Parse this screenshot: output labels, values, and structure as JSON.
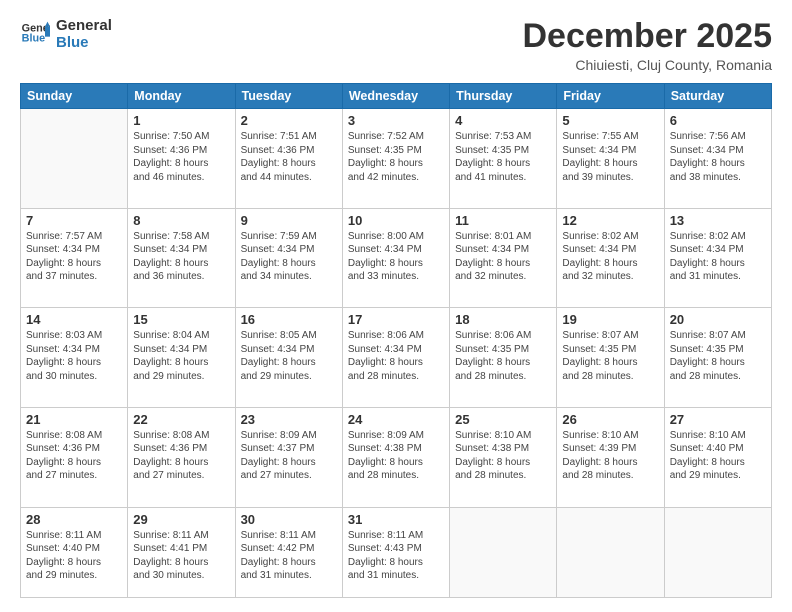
{
  "header": {
    "logo_line1": "General",
    "logo_line2": "Blue",
    "month": "December 2025",
    "location": "Chiuiesti, Cluj County, Romania"
  },
  "days_of_week": [
    "Sunday",
    "Monday",
    "Tuesday",
    "Wednesday",
    "Thursday",
    "Friday",
    "Saturday"
  ],
  "weeks": [
    [
      {
        "day": "",
        "info": ""
      },
      {
        "day": "1",
        "info": "Sunrise: 7:50 AM\nSunset: 4:36 PM\nDaylight: 8 hours\nand 46 minutes."
      },
      {
        "day": "2",
        "info": "Sunrise: 7:51 AM\nSunset: 4:36 PM\nDaylight: 8 hours\nand 44 minutes."
      },
      {
        "day": "3",
        "info": "Sunrise: 7:52 AM\nSunset: 4:35 PM\nDaylight: 8 hours\nand 42 minutes."
      },
      {
        "day": "4",
        "info": "Sunrise: 7:53 AM\nSunset: 4:35 PM\nDaylight: 8 hours\nand 41 minutes."
      },
      {
        "day": "5",
        "info": "Sunrise: 7:55 AM\nSunset: 4:34 PM\nDaylight: 8 hours\nand 39 minutes."
      },
      {
        "day": "6",
        "info": "Sunrise: 7:56 AM\nSunset: 4:34 PM\nDaylight: 8 hours\nand 38 minutes."
      }
    ],
    [
      {
        "day": "7",
        "info": "Sunrise: 7:57 AM\nSunset: 4:34 PM\nDaylight: 8 hours\nand 37 minutes."
      },
      {
        "day": "8",
        "info": "Sunrise: 7:58 AM\nSunset: 4:34 PM\nDaylight: 8 hours\nand 36 minutes."
      },
      {
        "day": "9",
        "info": "Sunrise: 7:59 AM\nSunset: 4:34 PM\nDaylight: 8 hours\nand 34 minutes."
      },
      {
        "day": "10",
        "info": "Sunrise: 8:00 AM\nSunset: 4:34 PM\nDaylight: 8 hours\nand 33 minutes."
      },
      {
        "day": "11",
        "info": "Sunrise: 8:01 AM\nSunset: 4:34 PM\nDaylight: 8 hours\nand 32 minutes."
      },
      {
        "day": "12",
        "info": "Sunrise: 8:02 AM\nSunset: 4:34 PM\nDaylight: 8 hours\nand 32 minutes."
      },
      {
        "day": "13",
        "info": "Sunrise: 8:02 AM\nSunset: 4:34 PM\nDaylight: 8 hours\nand 31 minutes."
      }
    ],
    [
      {
        "day": "14",
        "info": "Sunrise: 8:03 AM\nSunset: 4:34 PM\nDaylight: 8 hours\nand 30 minutes."
      },
      {
        "day": "15",
        "info": "Sunrise: 8:04 AM\nSunset: 4:34 PM\nDaylight: 8 hours\nand 29 minutes."
      },
      {
        "day": "16",
        "info": "Sunrise: 8:05 AM\nSunset: 4:34 PM\nDaylight: 8 hours\nand 29 minutes."
      },
      {
        "day": "17",
        "info": "Sunrise: 8:06 AM\nSunset: 4:34 PM\nDaylight: 8 hours\nand 28 minutes."
      },
      {
        "day": "18",
        "info": "Sunrise: 8:06 AM\nSunset: 4:35 PM\nDaylight: 8 hours\nand 28 minutes."
      },
      {
        "day": "19",
        "info": "Sunrise: 8:07 AM\nSunset: 4:35 PM\nDaylight: 8 hours\nand 28 minutes."
      },
      {
        "day": "20",
        "info": "Sunrise: 8:07 AM\nSunset: 4:35 PM\nDaylight: 8 hours\nand 28 minutes."
      }
    ],
    [
      {
        "day": "21",
        "info": "Sunrise: 8:08 AM\nSunset: 4:36 PM\nDaylight: 8 hours\nand 27 minutes."
      },
      {
        "day": "22",
        "info": "Sunrise: 8:08 AM\nSunset: 4:36 PM\nDaylight: 8 hours\nand 27 minutes."
      },
      {
        "day": "23",
        "info": "Sunrise: 8:09 AM\nSunset: 4:37 PM\nDaylight: 8 hours\nand 27 minutes."
      },
      {
        "day": "24",
        "info": "Sunrise: 8:09 AM\nSunset: 4:38 PM\nDaylight: 8 hours\nand 28 minutes."
      },
      {
        "day": "25",
        "info": "Sunrise: 8:10 AM\nSunset: 4:38 PM\nDaylight: 8 hours\nand 28 minutes."
      },
      {
        "day": "26",
        "info": "Sunrise: 8:10 AM\nSunset: 4:39 PM\nDaylight: 8 hours\nand 28 minutes."
      },
      {
        "day": "27",
        "info": "Sunrise: 8:10 AM\nSunset: 4:40 PM\nDaylight: 8 hours\nand 29 minutes."
      }
    ],
    [
      {
        "day": "28",
        "info": "Sunrise: 8:11 AM\nSunset: 4:40 PM\nDaylight: 8 hours\nand 29 minutes."
      },
      {
        "day": "29",
        "info": "Sunrise: 8:11 AM\nSunset: 4:41 PM\nDaylight: 8 hours\nand 30 minutes."
      },
      {
        "day": "30",
        "info": "Sunrise: 8:11 AM\nSunset: 4:42 PM\nDaylight: 8 hours\nand 31 minutes."
      },
      {
        "day": "31",
        "info": "Sunrise: 8:11 AM\nSunset: 4:43 PM\nDaylight: 8 hours\nand 31 minutes."
      },
      {
        "day": "",
        "info": ""
      },
      {
        "day": "",
        "info": ""
      },
      {
        "day": "",
        "info": ""
      }
    ]
  ]
}
